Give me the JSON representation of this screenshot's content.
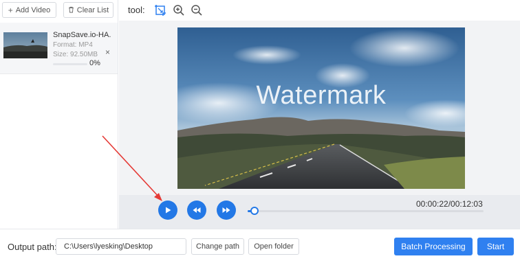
{
  "sidebar": {
    "add_video_label": "Add Video",
    "clear_list_label": "Clear List",
    "file": {
      "name": "SnapSave.io-HA...",
      "format": "Format:  MP4",
      "size": "Size:  92.50MB",
      "progress": 0,
      "progress_text": "0%"
    },
    "remove_glyph": "×"
  },
  "toolbar": {
    "label": "tool:",
    "icons": [
      "crop-icon",
      "zoom-in-icon",
      "zoom-out-icon"
    ]
  },
  "preview": {
    "watermark_text": "Watermark"
  },
  "player": {
    "time_text": "00:00:22/00:12:03",
    "position_fraction": 0.03,
    "buttons": [
      "play-icon",
      "rewind-icon",
      "fast-forward-icon"
    ]
  },
  "bottom": {
    "output_label": "Output path:",
    "output_value": "C:\\Users\\lyesking\\Desktop",
    "change_path_label": "Change path",
    "open_folder_label": "Open folder",
    "batch_label": "Batch Processing",
    "start_label": "Start"
  },
  "colors": {
    "accent": "#2f80f0",
    "player_button": "#2378e6",
    "annotation_arrow": "#e53935"
  }
}
